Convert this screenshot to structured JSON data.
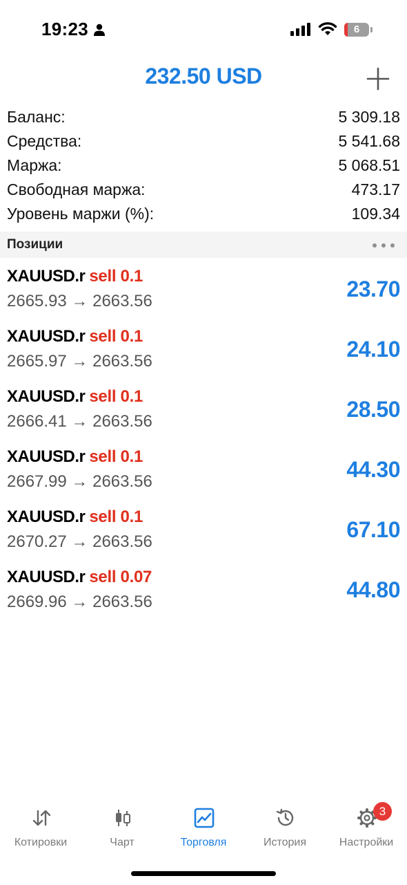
{
  "status_bar": {
    "time": "19:23",
    "battery_level": "6",
    "icons": [
      "person-icon",
      "cellular-signal-icon",
      "wifi-icon",
      "battery-icon"
    ]
  },
  "header": {
    "total": "232.50 USD",
    "add_icon": "plus-icon"
  },
  "account": [
    {
      "label": "Баланс:",
      "value": "5 309.18"
    },
    {
      "label": "Средства:",
      "value": "5 541.68"
    },
    {
      "label": "Маржа:",
      "value": "5 068.51"
    },
    {
      "label": "Свободная маржа:",
      "value": "473.17"
    },
    {
      "label": "Уровень маржи (%):",
      "value": "109.34"
    }
  ],
  "positions": {
    "title": "Позиции",
    "items": [
      {
        "symbol": "XAUUSD.r",
        "side": "sell 0.1",
        "prices": "2665.93 → 2663.56",
        "profit": "23.70"
      },
      {
        "symbol": "XAUUSD.r",
        "side": "sell 0.1",
        "prices": "2665.97 → 2663.56",
        "profit": "24.10"
      },
      {
        "symbol": "XAUUSD.r",
        "side": "sell 0.1",
        "prices": "2666.41 → 2663.56",
        "profit": "28.50"
      },
      {
        "symbol": "XAUUSD.r",
        "side": "sell 0.1",
        "prices": "2667.99 → 2663.56",
        "profit": "44.30"
      },
      {
        "symbol": "XAUUSD.r",
        "side": "sell 0.1",
        "prices": "2670.27 → 2663.56",
        "profit": "67.10"
      },
      {
        "symbol": "XAUUSD.r",
        "side": "sell 0.07",
        "prices": "2669.96 → 2663.56",
        "profit": "44.80"
      }
    ]
  },
  "tabs": [
    {
      "label": "Котировки",
      "icon": "quotes-arrows-icon",
      "active": false
    },
    {
      "label": "Чарт",
      "icon": "candlestick-chart-icon",
      "active": false
    },
    {
      "label": "Торговля",
      "icon": "trade-chart-icon",
      "active": true
    },
    {
      "label": "История",
      "icon": "history-clock-icon",
      "active": false
    },
    {
      "label": "Настройки",
      "icon": "settings-gear-icon",
      "active": false
    }
  ],
  "settings_badge": "3",
  "colors": {
    "accent": "#1e7fe0",
    "sell": "#e0301e",
    "badge": "#e53935",
    "section_bg": "#f4f4f4"
  }
}
